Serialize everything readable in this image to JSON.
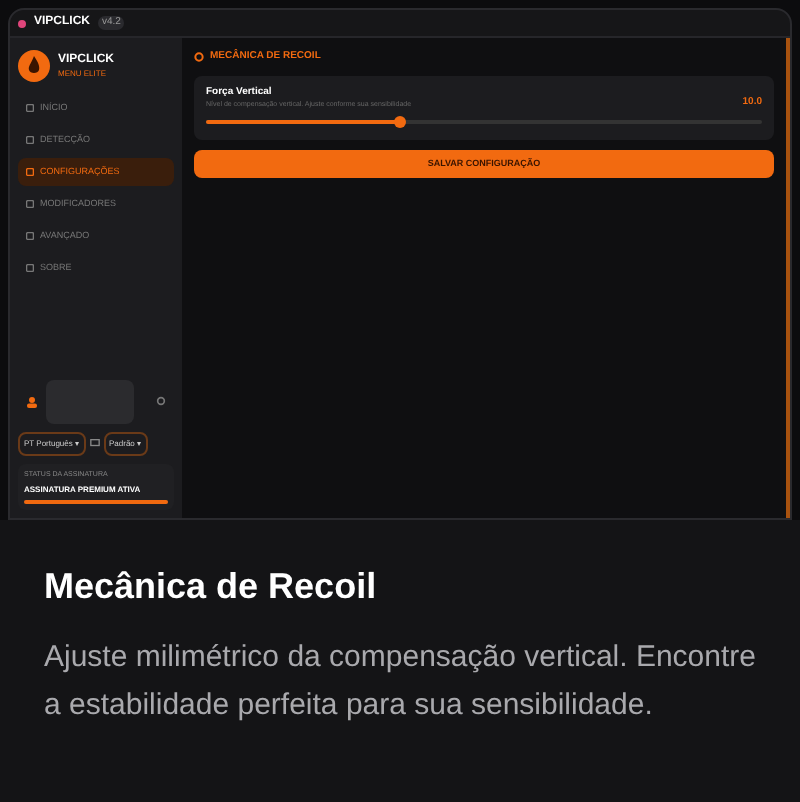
{
  "window": {
    "title": "VIPCLICK",
    "version": "v4.2"
  },
  "brand": {
    "name": "VIPCLICK",
    "subtitle": "MENU ELITE"
  },
  "sidebar": {
    "items": [
      {
        "label": "INÍCIO",
        "selected": false
      },
      {
        "label": "DETECÇÃO",
        "selected": false
      },
      {
        "label": "CONFIGURAÇÕES",
        "selected": true
      },
      {
        "label": "MODIFICADORES",
        "selected": false
      },
      {
        "label": "AVANÇADO",
        "selected": false
      },
      {
        "label": "SOBRE",
        "selected": false
      }
    ]
  },
  "footer": {
    "language": "PT Português ▾",
    "mode": "Padrão ▾",
    "status_label": "STATUS DA ASSINATURA",
    "status": "ASSINATURA PREMIUM ATIVA",
    "level": 1
  },
  "section": {
    "title": "MECÂNICA DE RECOIL"
  },
  "slider": {
    "name": "Força Vertical",
    "description": "Nível de compensação vertical. Ajuste conforme sua sensibilidade",
    "reading": "10.0",
    "level": 0.35
  },
  "save_button": "SALVAR CONFIGURAÇÃO",
  "caption": {
    "title": "Mecânica de Recoil",
    "text": "Ajuste milimétrico da compensação vertical. Encontre a estabilidade perfeita para sua sensibilidade."
  }
}
